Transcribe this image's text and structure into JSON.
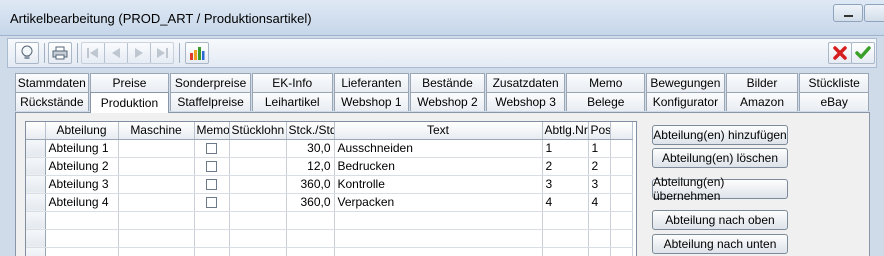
{
  "window": {
    "title": "Artikelbearbeitung (PROD_ART / Produktionsartikel)"
  },
  "toolbar": {
    "buttons": [
      {
        "icon": "lightbulb-icon"
      },
      {
        "icon": "printer-icon"
      },
      {
        "icon": "first-record-icon"
      },
      {
        "icon": "previous-record-icon"
      },
      {
        "icon": "next-record-icon"
      },
      {
        "icon": "last-record-icon"
      },
      {
        "icon": "bar-chart-icon"
      }
    ],
    "right_buttons": [
      {
        "icon": "cancel-icon",
        "color": "#d62020"
      },
      {
        "icon": "confirm-icon",
        "color": "#3aa02a"
      }
    ]
  },
  "tabs": {
    "row1": [
      "Stammdaten",
      "Preise",
      "Sonderpreise",
      "EK-Info",
      "Lieferanten",
      "Bestände",
      "Zusatzdaten",
      "Memo",
      "Bewegungen",
      "Bilder",
      "Stückliste"
    ],
    "row2": [
      "Rückstände",
      "Produktion",
      "Staffelpreise",
      "Leihartikel",
      "Webshop 1",
      "Webshop 2",
      "Webshop 3",
      "Belege",
      "Konfigurator",
      "Amazon",
      "eBay"
    ],
    "active": "Produktion"
  },
  "grid": {
    "columns": [
      "Abteilung",
      "Maschine",
      "Memo",
      "Stücklohn",
      "Stck./Std",
      "Text",
      "Abtlg.Nr",
      "Pos"
    ],
    "rows": [
      {
        "abteilung": "Abteilung 1",
        "maschine": "",
        "memo": false,
        "stuecklohn": "",
        "stck_std": "30,0",
        "text": "Ausschneiden",
        "abtlg_nr": "1",
        "pos": "1"
      },
      {
        "abteilung": "Abteilung 2",
        "maschine": "",
        "memo": false,
        "stuecklohn": "",
        "stck_std": "12,0",
        "text": "Bedrucken",
        "abtlg_nr": "2",
        "pos": "2"
      },
      {
        "abteilung": "Abteilung 3",
        "maschine": "",
        "memo": false,
        "stuecklohn": "",
        "stck_std": "360,0",
        "text": "Kontrolle",
        "abtlg_nr": "3",
        "pos": "3"
      },
      {
        "abteilung": "Abteilung 4",
        "maschine": "",
        "memo": false,
        "stuecklohn": "",
        "stck_std": "360,0",
        "text": "Verpacken",
        "abtlg_nr": "4",
        "pos": "4"
      }
    ]
  },
  "actions": {
    "add": "Abteilung(en) hinzufügen",
    "delete": "Abteilung(en) löschen",
    "apply": "Abteilung(en) übernehmen",
    "up": "Abteilung nach oben",
    "down": "Abteilung nach unten"
  }
}
